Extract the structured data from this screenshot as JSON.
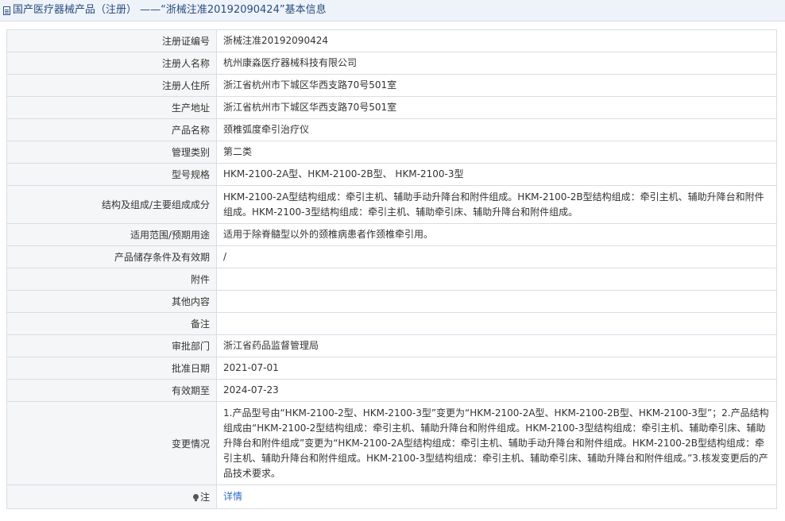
{
  "header": {
    "icon": "document-icon",
    "title": "国产医疗器械产品（注册） ——“浙械注准20192090424”基本信息"
  },
  "fields": [
    {
      "label": "注册证编号",
      "value": "浙械注准20192090424"
    },
    {
      "label": "注册人名称",
      "value": "杭州康淼医疗器械科技有限公司"
    },
    {
      "label": "注册人住所",
      "value": "浙江省杭州市下城区华西支路70号501室"
    },
    {
      "label": "生产地址",
      "value": "浙江省杭州市下城区华西支路70号501室"
    },
    {
      "label": "产品名称",
      "value": "颈椎弧度牵引治疗仪"
    },
    {
      "label": "管理类别",
      "value": "第二类"
    },
    {
      "label": "型号规格",
      "value": "HKM-2100-2A型、HKM-2100-2B型、 HKM-2100-3型"
    },
    {
      "label": "结构及组成/主要组成成分",
      "value": "HKM-2100-2A型结构组成：牵引主机、辅助手动升降台和附件组成。HKM-2100-2B型结构组成：牵引主机、辅助升降台和附件组成。HKM-2100-3型结构组成：牵引主机、辅助牵引床、辅助升降台和附件组成。"
    },
    {
      "label": "适用范围/预期用途",
      "value": "适用于除脊髓型以外的颈椎病患者作颈椎牵引用。"
    },
    {
      "label": "产品储存条件及有效期",
      "value": "/"
    },
    {
      "label": "附件",
      "value": ""
    },
    {
      "label": "其他内容",
      "value": ""
    },
    {
      "label": "备注",
      "value": ""
    },
    {
      "label": "审批部门",
      "value": "浙江省药品监督管理局"
    },
    {
      "label": "批准日期",
      "value": "2021-07-01"
    },
    {
      "label": "有效期至",
      "value": "2024-07-23"
    },
    {
      "label": "变更情况",
      "value": "1.产品型号由“HKM-2100-2型、HKM-2100-3型”变更为“HKM-2100-2A型、HKM-2100-2B型、HKM-2100-3型”；2.产品结构组成由“HKM-2100-2型结构组成：牵引主机、辅助升降台和附件组成。HKM-2100-3型结构组成：牵引主机、辅助牵引床、辅助升降台和附件组成”变更为“HKM-2100-2A型结构组成：牵引主机、辅助手动升降台和附件组成。HKM-2100-2B型结构组成：牵引主机、辅助升降台和附件组成。HKM-2100-3型结构组成：牵引主机、辅助牵引床、辅助升降台和附件组成。”3.核发变更后的产品技术要求。"
    }
  ],
  "note": {
    "icon": "lightbulb-icon",
    "label": "注",
    "link_text": "详情",
    "link_color": "#2f6bc9"
  }
}
